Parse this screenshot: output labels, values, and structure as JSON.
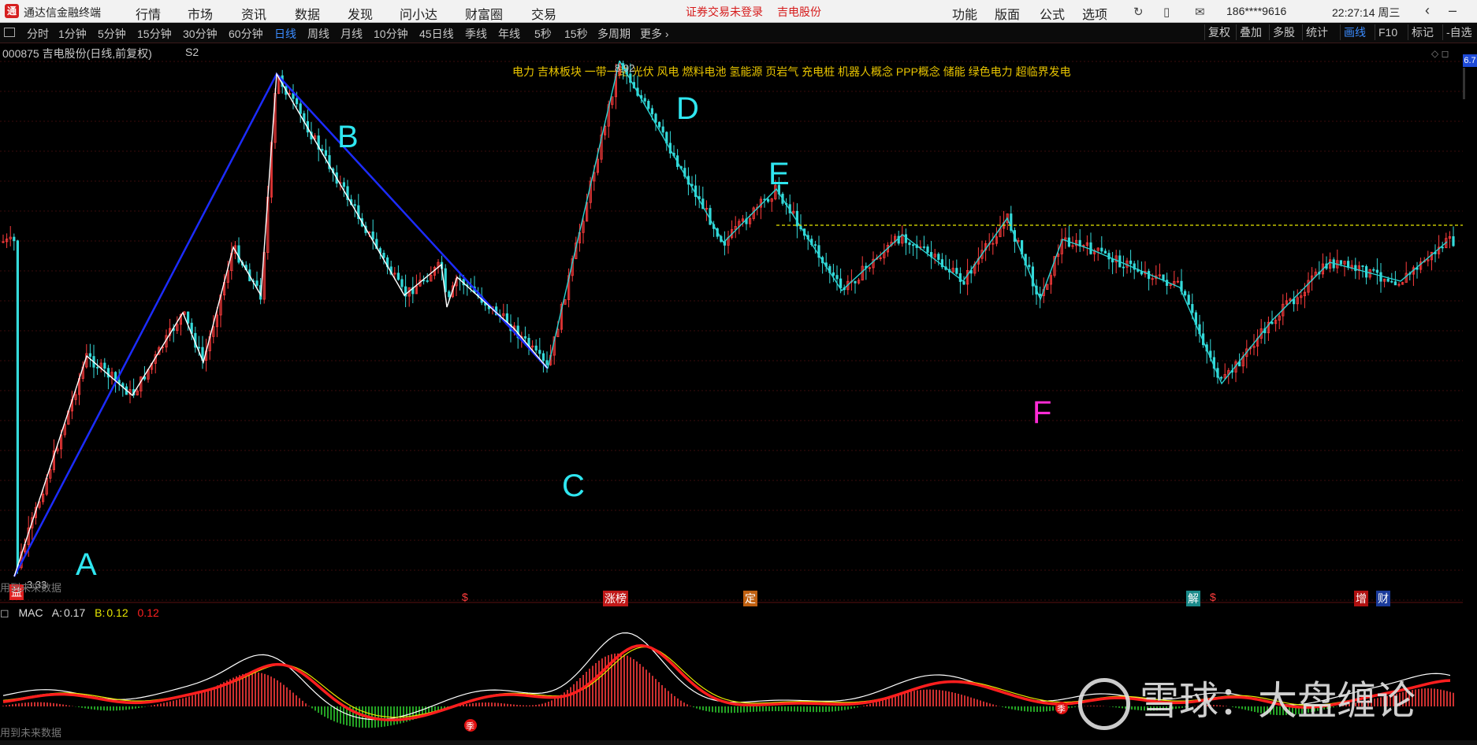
{
  "window": {
    "app_title": "通达信金融终端",
    "menu": [
      "行情",
      "市场",
      "资讯",
      "数据",
      "发现",
      "问小达",
      "财富圈",
      "交易"
    ],
    "notice": "证券交易未登录",
    "notice_stock": "吉电股份",
    "right_menu": [
      "功能",
      "版面",
      "公式",
      "选项"
    ],
    "account": "186****9616",
    "time": "22:27:14 周三"
  },
  "toolbar": {
    "periods": [
      "分时",
      "1分钟",
      "5分钟",
      "15分钟",
      "30分钟",
      "60分钟",
      "日线",
      "周线",
      "月线",
      "10分钟",
      "45日线",
      "季线",
      "年线",
      "5秒",
      "15秒",
      "多周期",
      "更多"
    ],
    "active_period": "日线",
    "right_buttons": [
      "复权",
      "叠加",
      "多股",
      "统计",
      "画线",
      "F10",
      "标记",
      "-自选"
    ],
    "active_right": "画线"
  },
  "chart_header": {
    "stock_title": "000875 吉电股份(日线,前复权)",
    "indicator_tag": "S2",
    "concepts": "电力 吉林板块 一带一路 光伏 风电 燃料电池 氢能源 页岩气 充电桩 机器人概念 PPP概念 储能 绿色电力 超临界发电",
    "price_badge": "6.7",
    "high_label": "8.92",
    "low_label": "3.33"
  },
  "wave_labels": {
    "A": "A",
    "B": "B",
    "C": "C",
    "D": "D",
    "E": "E",
    "F": "F"
  },
  "event_markers": [
    "益",
    "$",
    "涨榜",
    "定",
    "解",
    "$",
    "增",
    "财"
  ],
  "macd": {
    "name": "MAC",
    "a_label": "A:",
    "a_value": "0.17",
    "b_label": "B:",
    "b_value": "0.12",
    "extra_value": "0.12",
    "markers": [
      "季",
      "季"
    ]
  },
  "future_note": "用到未来数据",
  "watermark": "雪球：大盘缠论",
  "colors": {
    "up": "#ff3c3c",
    "down": "#35dada",
    "wave_blue": "#1c2cff",
    "wave_white": "#ffffff",
    "wave_cyan": "#2ad4d4",
    "label_cyan": "#2fe6f0",
    "label_magenta": "#ff2bd6",
    "dash_line": "#e8e800",
    "macd_red": "#ff1e1e",
    "macd_yellow": "#e6e600"
  }
}
